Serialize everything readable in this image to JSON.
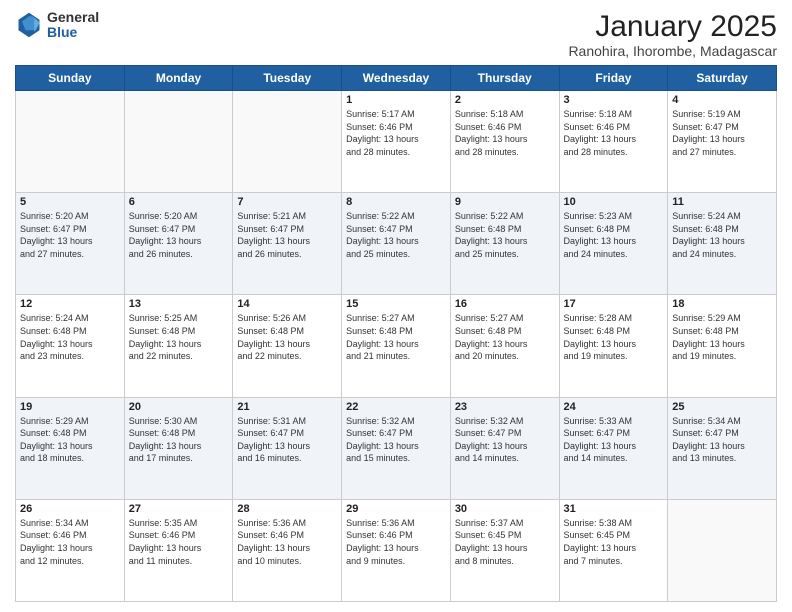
{
  "header": {
    "logo_general": "General",
    "logo_blue": "Blue",
    "title": "January 2025",
    "location": "Ranohira, Ihorombe, Madagascar"
  },
  "weekdays": [
    "Sunday",
    "Monday",
    "Tuesday",
    "Wednesday",
    "Thursday",
    "Friday",
    "Saturday"
  ],
  "weeks": [
    [
      {
        "day": "",
        "info": ""
      },
      {
        "day": "",
        "info": ""
      },
      {
        "day": "",
        "info": ""
      },
      {
        "day": "1",
        "info": "Sunrise: 5:17 AM\nSunset: 6:46 PM\nDaylight: 13 hours\nand 28 minutes."
      },
      {
        "day": "2",
        "info": "Sunrise: 5:18 AM\nSunset: 6:46 PM\nDaylight: 13 hours\nand 28 minutes."
      },
      {
        "day": "3",
        "info": "Sunrise: 5:18 AM\nSunset: 6:46 PM\nDaylight: 13 hours\nand 28 minutes."
      },
      {
        "day": "4",
        "info": "Sunrise: 5:19 AM\nSunset: 6:47 PM\nDaylight: 13 hours\nand 27 minutes."
      }
    ],
    [
      {
        "day": "5",
        "info": "Sunrise: 5:20 AM\nSunset: 6:47 PM\nDaylight: 13 hours\nand 27 minutes."
      },
      {
        "day": "6",
        "info": "Sunrise: 5:20 AM\nSunset: 6:47 PM\nDaylight: 13 hours\nand 26 minutes."
      },
      {
        "day": "7",
        "info": "Sunrise: 5:21 AM\nSunset: 6:47 PM\nDaylight: 13 hours\nand 26 minutes."
      },
      {
        "day": "8",
        "info": "Sunrise: 5:22 AM\nSunset: 6:47 PM\nDaylight: 13 hours\nand 25 minutes."
      },
      {
        "day": "9",
        "info": "Sunrise: 5:22 AM\nSunset: 6:48 PM\nDaylight: 13 hours\nand 25 minutes."
      },
      {
        "day": "10",
        "info": "Sunrise: 5:23 AM\nSunset: 6:48 PM\nDaylight: 13 hours\nand 24 minutes."
      },
      {
        "day": "11",
        "info": "Sunrise: 5:24 AM\nSunset: 6:48 PM\nDaylight: 13 hours\nand 24 minutes."
      }
    ],
    [
      {
        "day": "12",
        "info": "Sunrise: 5:24 AM\nSunset: 6:48 PM\nDaylight: 13 hours\nand 23 minutes."
      },
      {
        "day": "13",
        "info": "Sunrise: 5:25 AM\nSunset: 6:48 PM\nDaylight: 13 hours\nand 22 minutes."
      },
      {
        "day": "14",
        "info": "Sunrise: 5:26 AM\nSunset: 6:48 PM\nDaylight: 13 hours\nand 22 minutes."
      },
      {
        "day": "15",
        "info": "Sunrise: 5:27 AM\nSunset: 6:48 PM\nDaylight: 13 hours\nand 21 minutes."
      },
      {
        "day": "16",
        "info": "Sunrise: 5:27 AM\nSunset: 6:48 PM\nDaylight: 13 hours\nand 20 minutes."
      },
      {
        "day": "17",
        "info": "Sunrise: 5:28 AM\nSunset: 6:48 PM\nDaylight: 13 hours\nand 19 minutes."
      },
      {
        "day": "18",
        "info": "Sunrise: 5:29 AM\nSunset: 6:48 PM\nDaylight: 13 hours\nand 19 minutes."
      }
    ],
    [
      {
        "day": "19",
        "info": "Sunrise: 5:29 AM\nSunset: 6:48 PM\nDaylight: 13 hours\nand 18 minutes."
      },
      {
        "day": "20",
        "info": "Sunrise: 5:30 AM\nSunset: 6:48 PM\nDaylight: 13 hours\nand 17 minutes."
      },
      {
        "day": "21",
        "info": "Sunrise: 5:31 AM\nSunset: 6:47 PM\nDaylight: 13 hours\nand 16 minutes."
      },
      {
        "day": "22",
        "info": "Sunrise: 5:32 AM\nSunset: 6:47 PM\nDaylight: 13 hours\nand 15 minutes."
      },
      {
        "day": "23",
        "info": "Sunrise: 5:32 AM\nSunset: 6:47 PM\nDaylight: 13 hours\nand 14 minutes."
      },
      {
        "day": "24",
        "info": "Sunrise: 5:33 AM\nSunset: 6:47 PM\nDaylight: 13 hours\nand 14 minutes."
      },
      {
        "day": "25",
        "info": "Sunrise: 5:34 AM\nSunset: 6:47 PM\nDaylight: 13 hours\nand 13 minutes."
      }
    ],
    [
      {
        "day": "26",
        "info": "Sunrise: 5:34 AM\nSunset: 6:46 PM\nDaylight: 13 hours\nand 12 minutes."
      },
      {
        "day": "27",
        "info": "Sunrise: 5:35 AM\nSunset: 6:46 PM\nDaylight: 13 hours\nand 11 minutes."
      },
      {
        "day": "28",
        "info": "Sunrise: 5:36 AM\nSunset: 6:46 PM\nDaylight: 13 hours\nand 10 minutes."
      },
      {
        "day": "29",
        "info": "Sunrise: 5:36 AM\nSunset: 6:46 PM\nDaylight: 13 hours\nand 9 minutes."
      },
      {
        "day": "30",
        "info": "Sunrise: 5:37 AM\nSunset: 6:45 PM\nDaylight: 13 hours\nand 8 minutes."
      },
      {
        "day": "31",
        "info": "Sunrise: 5:38 AM\nSunset: 6:45 PM\nDaylight: 13 hours\nand 7 minutes."
      },
      {
        "day": "",
        "info": ""
      }
    ]
  ]
}
